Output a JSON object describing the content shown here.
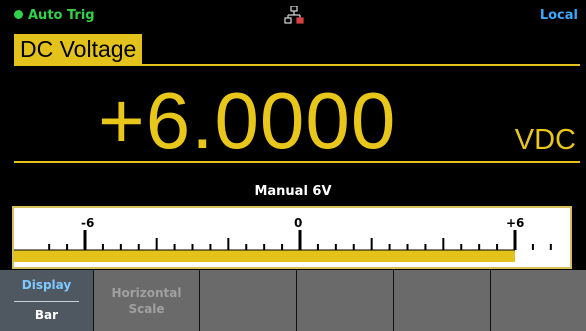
{
  "status": {
    "trigger_label": "Auto Trig",
    "network_icon": "lan-connected-icon",
    "mode_label": "Local"
  },
  "measurement": {
    "function_label": "DC Voltage",
    "reading": "+6.0000",
    "unit": "VDC",
    "range_label": "Manual 6V"
  },
  "bar": {
    "tick_labels": {
      "min": "-6",
      "mid": "0",
      "max": "+6"
    },
    "range_min": -6,
    "range_max": 6,
    "value": 6.0
  },
  "softkeys": {
    "display": {
      "label": "Display",
      "value": "Bar"
    },
    "horizontal_scale": {
      "label_line1": "Horizontal",
      "label_line2": "Scale"
    }
  },
  "colors": {
    "accent": "#e3c31b",
    "trigger": "#2fd24a",
    "local": "#3aa8ff"
  }
}
